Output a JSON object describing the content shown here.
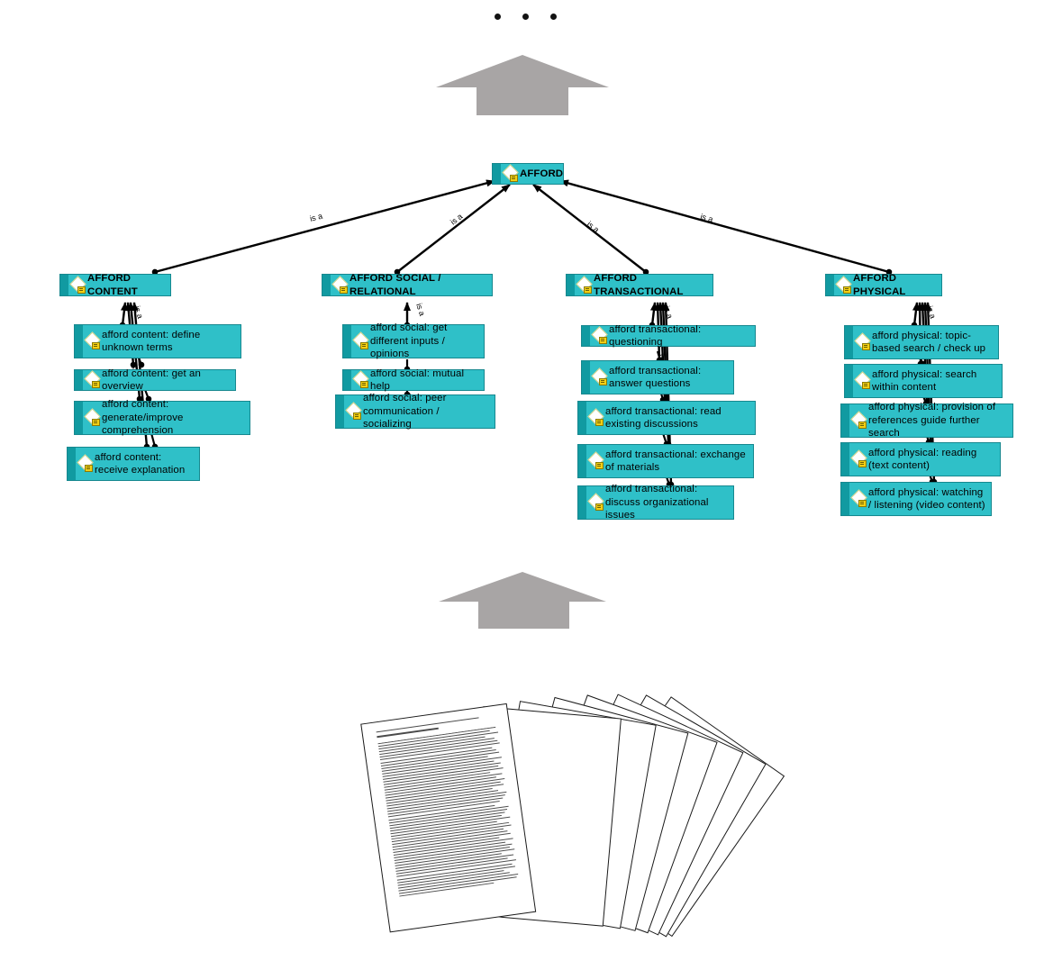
{
  "diagram": {
    "title": "AFFORD hierarchy",
    "root": {
      "label": "AFFORD",
      "icon": "concept-diamond-icon"
    },
    "edge_label": "is a",
    "colors": {
      "node_fill": "#2fc0c8",
      "node_band": "#119aa1",
      "node_border": "#17888f",
      "block_arrow": "#a8a5a5",
      "edge": "#000000"
    },
    "categories": [
      {
        "label": "AFFORD CONTENT",
        "children": [
          {
            "label": "afford content: define unknown terms"
          },
          {
            "label": "afford content: get an overview"
          },
          {
            "label": "afford content: generate/improve comprehension"
          },
          {
            "label": "afford content: receive explanation"
          }
        ]
      },
      {
        "label": "AFFORD SOCIAL / RELATIONAL",
        "children": [
          {
            "label": "afford social: get different inputs / opinions"
          },
          {
            "label": "afford social: mutual help"
          },
          {
            "label": "afford social: peer communication / socializing"
          }
        ]
      },
      {
        "label": "AFFORD TRANSACTIONAL",
        "children": [
          {
            "label": "afford transactional: questioning"
          },
          {
            "label": "afford transactional: answer questions"
          },
          {
            "label": "afford transactional: read existing discussions"
          },
          {
            "label": "afford transactional: exchange of materials"
          },
          {
            "label": "afford transactional: discuss organizational issues"
          }
        ]
      },
      {
        "label": "AFFORD PHYSICAL",
        "children": [
          {
            "label": "afford physical: topic-based search / check up"
          },
          {
            "label": "afford physical: search within content"
          },
          {
            "label": "afford physical: provision of references guide further search"
          },
          {
            "label": "afford physical: reading (text content)"
          },
          {
            "label": "afford physical: watching / listening (video content)"
          }
        ]
      }
    ],
    "decorations": {
      "ellipsis": "• • •",
      "top_arrow": "up-block-arrow",
      "bottom_arrow": "up-block-arrow",
      "document_stack": "document-stack-icon"
    }
  }
}
